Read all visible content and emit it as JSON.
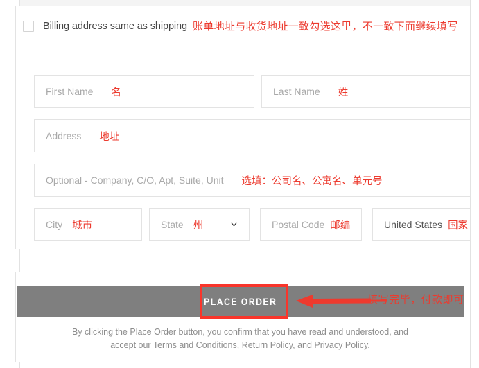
{
  "billing_card": {
    "checkbox": {
      "label": "Billing address same as shipping",
      "checked": false,
      "annotation": "账单地址与收货地址一致勾选这里，不一致下面继续填写"
    },
    "fields": [
      {
        "name": "first-name",
        "placeholder": "First Name",
        "value": "",
        "annotation": "名"
      },
      {
        "name": "last-name",
        "placeholder": "Last Name",
        "value": "",
        "annotation": "姓"
      },
      {
        "name": "address",
        "placeholder": "Address",
        "value": "",
        "annotation": "地址"
      },
      {
        "name": "address-2",
        "placeholder": "Optional - Company, C/O, Apt, Suite, Unit",
        "value": "",
        "annotation": "选填：公司名、公寓名、单元号"
      },
      {
        "name": "city",
        "placeholder": "City",
        "value": "",
        "annotation": "城市"
      },
      {
        "name": "state",
        "placeholder": "State",
        "value": "",
        "annotation": "州",
        "has_dropdown": true
      },
      {
        "name": "postal-code",
        "placeholder": "Postal Code",
        "value": "",
        "annotation": "邮编"
      },
      {
        "name": "country",
        "placeholder": "",
        "value": "United States",
        "annotation": "国家"
      }
    ]
  },
  "order_card": {
    "place_order_label": "PLACE ORDER",
    "place_order_annotation": "填写完毕，付款即可",
    "legal": {
      "line1": "By clicking the Place Order button, you confirm that you have read and understood, and",
      "line2_prefix": "accept our ",
      "link_terms": "Terms and Conditions",
      "sep1": ", ",
      "link_return": "Return Policy",
      "sep2": ", and ",
      "link_privacy": "Privacy Policy",
      "period": "."
    }
  },
  "colors": {
    "annotation_red": "#ec3a2e",
    "highlight_red": "#f9352b",
    "button_gray": "#7f7f7f",
    "border_gray": "#e3e3e3",
    "placeholder_gray": "#a9a9a9"
  }
}
